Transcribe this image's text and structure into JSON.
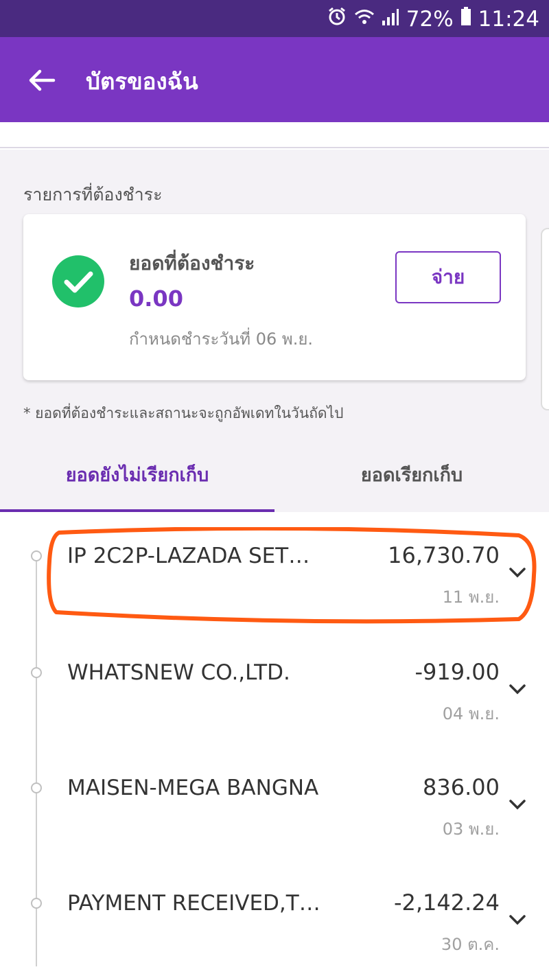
{
  "status_bar": {
    "battery": "72%",
    "time": "11:24",
    "icons": [
      "alarm-icon",
      "wifi-icon",
      "signal-icon",
      "battery-icon"
    ]
  },
  "app_bar": {
    "title": "บัตรของฉัน",
    "back_icon": "arrow-left-icon",
    "color": "#7a36c2"
  },
  "summary": {
    "section_title": "รายการที่ต้องชำระ",
    "due_label": "ยอดที่ต้องชำระ",
    "due_amount": "0.00",
    "due_date": "กำหนดชำระวันที่ 06 พ.ย.",
    "pay_label": "จ่าย",
    "status_icon": "check-circle-icon",
    "status_color": "#21c06a",
    "footnote": "* ยอดที่ต้องชำระและสถานะจะถูกอัพเดทในวันถัดไป"
  },
  "tabs": [
    {
      "label": "ยอดยังไม่เรียกเก็บ",
      "active": true
    },
    {
      "label": "ยอดเรียกเก็บ",
      "active": false
    }
  ],
  "transactions": [
    {
      "description": "IP 2C2P-LAZADA    SET…",
      "amount": "16,730.70",
      "date": "11 พ.ย.",
      "highlighted": true
    },
    {
      "description": "WHATSNEW CO.,LTD.",
      "amount": "-919.00",
      "date": "04 พ.ย.",
      "highlighted": false
    },
    {
      "description": "MAISEN-MEGA BANGNA",
      "amount": "836.00",
      "date": "03 พ.ย.",
      "highlighted": false
    },
    {
      "description": "PAYMENT RECEIVED,T…",
      "amount": "-2,142.24",
      "date": "30 ต.ค.",
      "highlighted": false
    }
  ],
  "annotation_color": "#ff5a12"
}
